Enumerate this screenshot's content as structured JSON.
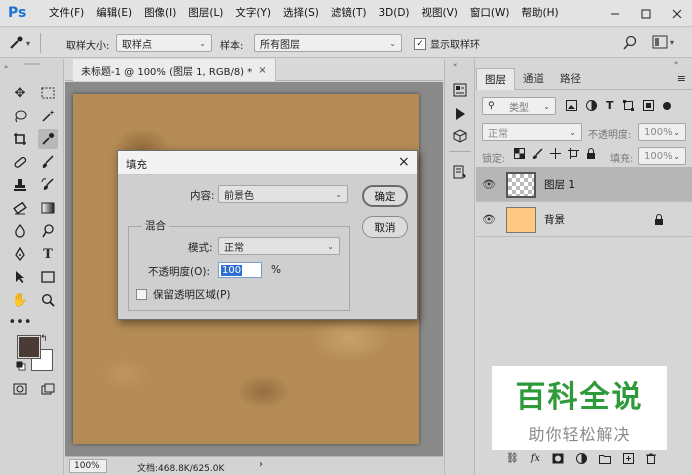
{
  "app": {
    "logo": "Ps"
  },
  "menu": [
    "文件(F)",
    "编辑(E)",
    "图像(I)",
    "图层(L)",
    "文字(Y)",
    "选择(S)",
    "滤镜(T)",
    "3D(D)",
    "视图(V)",
    "窗口(W)",
    "帮助(H)"
  ],
  "options_bar": {
    "sample_size_label": "取样大小:",
    "sample_size_value": "取样点",
    "sample_label": "样本:",
    "sample_value": "所有图层",
    "show_ring_label": "显示取样环",
    "show_ring_checked": true
  },
  "document": {
    "tab_title": "未标题-1 @ 100% (图层 1, RGB/8) *",
    "tab_close": "×",
    "zoom": "100%",
    "doc_info": "文档:468.8K/625.0K"
  },
  "layers_panel": {
    "tabs": [
      "图层",
      "通道",
      "路径"
    ],
    "active_tab": 0,
    "filter_kind": "类型",
    "blend_mode": "正常",
    "opacity_label": "不透明度:",
    "opacity_value": "100%",
    "lock_label": "锁定:",
    "fill_label": "填充:",
    "fill_value": "100%",
    "layers": [
      {
        "name": "图层 1",
        "selected": true,
        "transparent": true
      },
      {
        "name": "背景",
        "selected": false,
        "color": "#ffc882",
        "locked": true
      }
    ]
  },
  "dialog": {
    "title": "填充",
    "close": "×",
    "content_label": "内容:",
    "content_value": "前景色",
    "ok": "确定",
    "cancel": "取消",
    "blend_group_title": "混合",
    "mode_label": "模式:",
    "mode_value": "正常",
    "opacity_label": "不透明度(O):",
    "opacity_value": "100",
    "opacity_unit": "%",
    "preserve_label": "保留透明区域(P)",
    "preserve_checked": false
  },
  "colors": {
    "foreground": "#4a3b34",
    "background": "#ffffff",
    "accent_blue": "#1b72d6",
    "watermark_green": "#2e9a3a"
  },
  "watermark": {
    "title": "百科全说",
    "subtitle": "助你轻松解决"
  }
}
